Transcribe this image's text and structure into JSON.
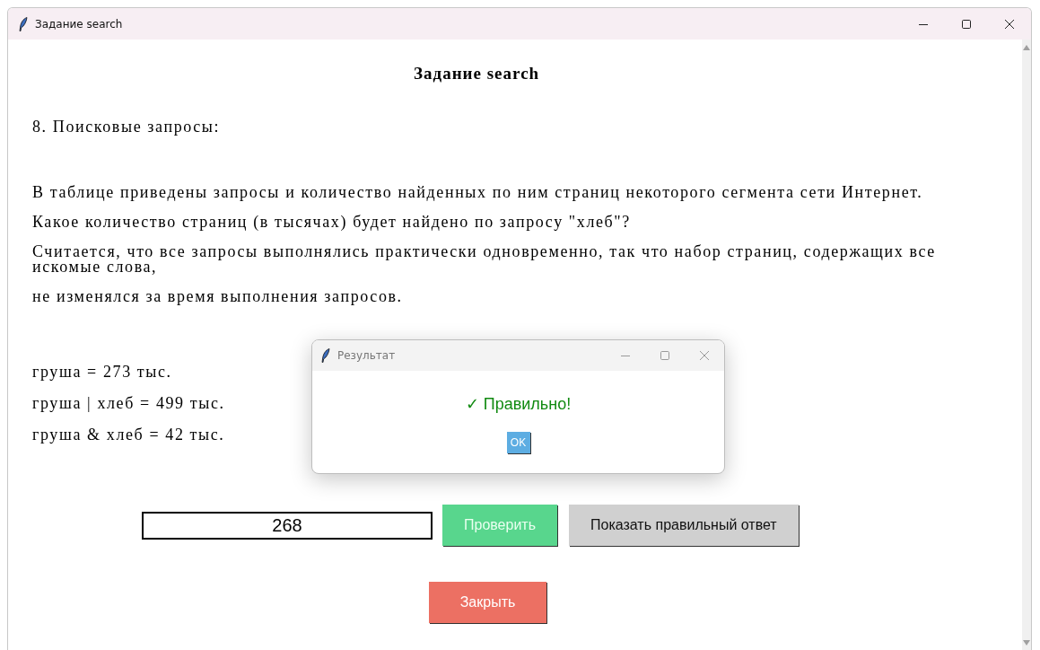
{
  "window": {
    "title": "Задание search"
  },
  "heading": "Задание search",
  "task_number": "8. Поисковые запросы:",
  "question_lines": [
    "В таблице приведены запросы и количество найденных по ним страниц некоторого сегмента сети Интернет.",
    "Какое количество страниц (в тысячах) будет найдено по запросу \"хлеб\"?",
    "Считается, что все запросы выполнялись практически одновременно, так что набор страниц, содержащих все искомые слова,",
    "не изменялся за время выполнения запросов."
  ],
  "data_lines": [
    "груша = 273 тыс.",
    "груша | хлеб = 499 тыс.",
    "груша & хлеб = 42 тыс."
  ],
  "answer_field": {
    "value": "268"
  },
  "buttons": [
    {
      "kind": "check",
      "label": "Проверить"
    },
    {
      "kind": "show",
      "label": "Показать правильный ответ"
    }
  ],
  "close_button": "Закрыть",
  "dialog": {
    "title": "Результат",
    "message": "✓ Правильно!",
    "ok": "OK"
  }
}
